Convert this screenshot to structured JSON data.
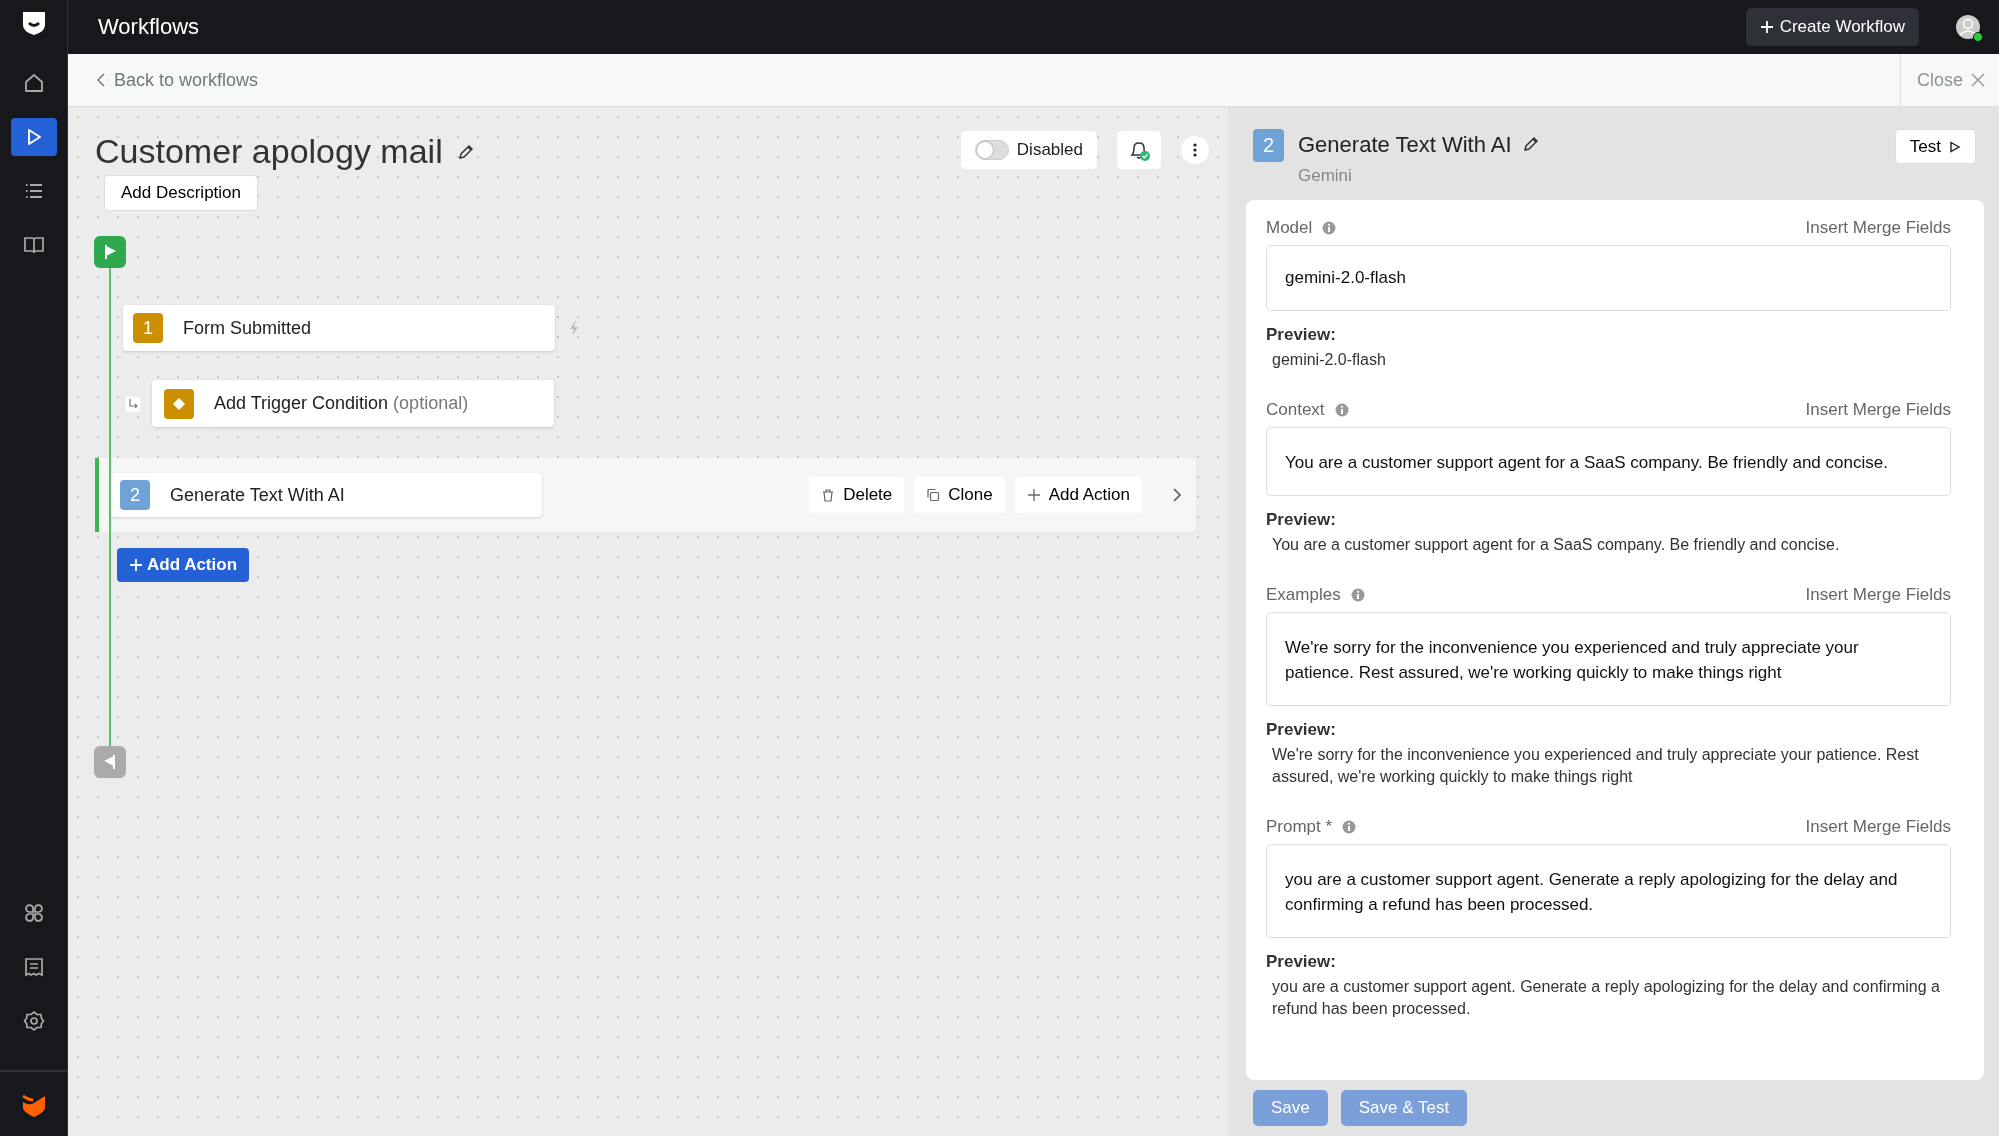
{
  "topbar": {
    "title": "Workflows",
    "create_button": "Create Workflow"
  },
  "sidebar": {
    "items": [
      {
        "kind": "home",
        "selected": false
      },
      {
        "kind": "play",
        "selected": true
      },
      {
        "kind": "list",
        "selected": false
      },
      {
        "kind": "book",
        "selected": false
      }
    ],
    "bottom_items": [
      {
        "kind": "apps",
        "selected": false
      },
      {
        "kind": "receipt",
        "selected": false
      },
      {
        "kind": "settings",
        "selected": false
      }
    ]
  },
  "subheader": {
    "back_link": "Back to workflows",
    "close": "Close"
  },
  "workflow": {
    "title": "Customer apology mail",
    "add_description": "Add Description",
    "toggle": {
      "label": "Disabled",
      "on": false
    }
  },
  "trigger": {
    "number": "1",
    "title": "Form Submitted"
  },
  "condition": {
    "title": "Add Trigger Condition",
    "hint": "(optional)"
  },
  "actions": [
    {
      "number": "2",
      "title": "Generate Text With AI",
      "selected": true,
      "buttons": [
        "Delete",
        "Clone",
        "Add Action"
      ]
    }
  ],
  "add_action": "Add Action",
  "panel": {
    "number": "2",
    "title": "Generate Text With AI",
    "subtitle": "Gemini",
    "test_button": "Test",
    "fields": [
      {
        "label": "Model",
        "merge": "Insert Merge Fields",
        "value": "gemini-2.0-flash",
        "preview_label": "Preview:",
        "preview": "gemini-2.0-flash"
      },
      {
        "label": "Context",
        "merge": "Insert Merge Fields",
        "value": "You are a customer support agent for a SaaS company. Be friendly and concise.",
        "preview_label": "Preview:",
        "preview": "You are a customer support agent for a SaaS company. Be friendly and concise."
      },
      {
        "label": "Examples",
        "merge": "Insert Merge Fields",
        "value": "We're sorry for the inconvenience you experienced and truly appreciate your patience. Rest assured, we're working quickly to make things right",
        "preview_label": "Preview:",
        "preview": "We're sorry for the inconvenience you experienced and truly appreciate your patience. Rest assured, we're working quickly to make things right"
      },
      {
        "label": "Prompt *",
        "merge": "Insert Merge Fields",
        "value": "you are a customer support agent. Generate a reply apologizing for the delay and confirming a refund has been processed.",
        "preview_label": "Preview:",
        "preview": "you are a customer support agent. Generate a reply apologizing for the delay and confirming a refund has been processed."
      }
    ],
    "buttons": [
      "Save",
      "Save & Test"
    ]
  }
}
